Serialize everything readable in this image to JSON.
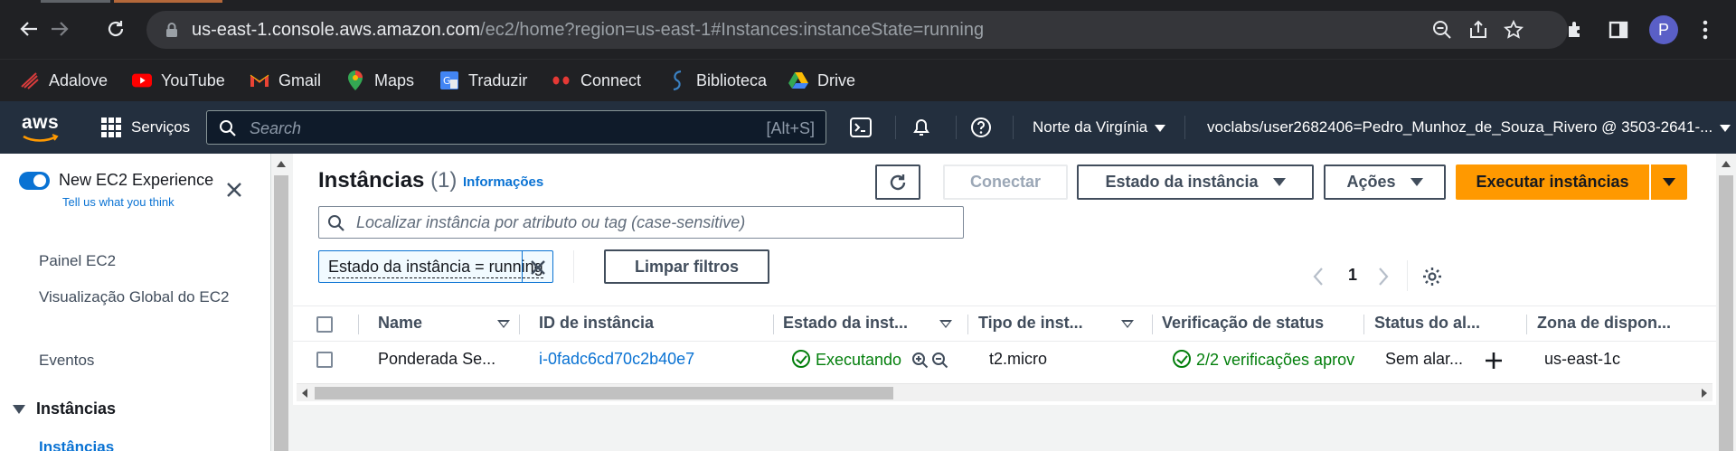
{
  "browser": {
    "url_host": "us-east-1.console.aws.amazon.com",
    "url_path": "/ec2/home?region=us-east-1#Instances:instanceState=running",
    "profile_initial": "P",
    "bookmarks": [
      {
        "label": "Adalove",
        "icon": "adalove-icon"
      },
      {
        "label": "YouTube",
        "icon": "youtube-icon"
      },
      {
        "label": "Gmail",
        "icon": "gmail-icon"
      },
      {
        "label": "Maps",
        "icon": "maps-icon"
      },
      {
        "label": "Traduzir",
        "icon": "translate-icon"
      },
      {
        "label": "Connect",
        "icon": "connect-icon"
      },
      {
        "label": "Biblioteca",
        "icon": "library-icon"
      },
      {
        "label": "Drive",
        "icon": "drive-icon"
      }
    ]
  },
  "aws_header": {
    "logo": "aws",
    "services_label": "Serviços",
    "search_placeholder": "Search",
    "search_shortcut": "[Alt+S]",
    "region_label": "Norte da Virgínia",
    "account_label": "voclabs/user2682406=Pedro_Munhoz_de_Souza_Rivero @ 3503-2641-..."
  },
  "sidebar": {
    "new_experience_label": "New EC2 Experience",
    "tell_us_link": "Tell us what you think",
    "links": [
      "Painel EC2",
      "Visualização Global do EC2",
      "Eventos"
    ],
    "section_label": "Instâncias",
    "active_item": "Instâncias"
  },
  "main": {
    "title": "Instâncias",
    "count": "(1)",
    "info_link": "Informações",
    "buttons": {
      "connect": "Conectar",
      "instance_state": "Estado da instância",
      "actions": "Ações",
      "launch": "Executar instâncias"
    },
    "filter_placeholder": "Localizar instância por atributo ou tag (case-sensitive)",
    "active_filter": "Estado da instância = running",
    "clear_filters": "Limpar filtros",
    "page_number": "1"
  },
  "table": {
    "columns": [
      "Name",
      "ID de instância",
      "Estado da inst...",
      "Tipo de inst...",
      "Verificação de status",
      "Status do al...",
      "Zona de dispon..."
    ],
    "rows": [
      {
        "name": "Ponderada Se...",
        "instance_id": "i-0fadc6cd70c2b40e7",
        "state": "Executando",
        "type": "t2.micro",
        "status_check": "2/2 verificações aprov",
        "alarm_status": "Sem alar...",
        "zone": "us-east-1c"
      }
    ]
  },
  "colors": {
    "aws_header": "#232f3e",
    "primary_button": "#ff9900",
    "link": "#0972d3",
    "success": "#037f0c"
  }
}
